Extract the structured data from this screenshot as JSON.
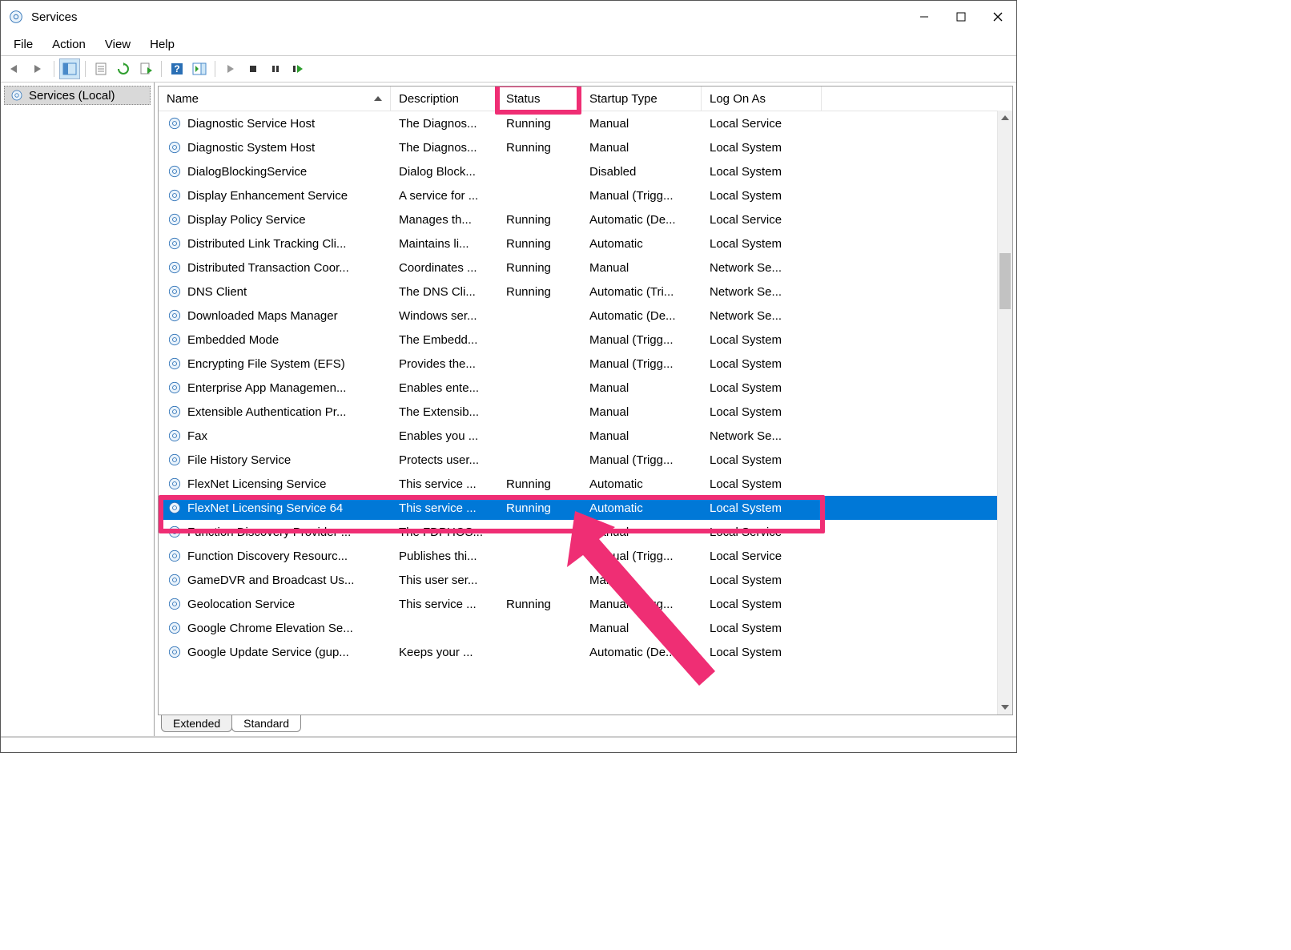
{
  "window": {
    "title": "Services"
  },
  "menubar": [
    "File",
    "Action",
    "View",
    "Help"
  ],
  "tree": {
    "root": "Services (Local)"
  },
  "columns": {
    "name": "Name",
    "description": "Description",
    "status": "Status",
    "startup": "Startup Type",
    "logon": "Log On As"
  },
  "tabs": {
    "extended": "Extended",
    "standard": "Standard"
  },
  "selected_index": 16,
  "highlight_column_index": 2,
  "services": [
    {
      "name": "Diagnostic Service Host",
      "description": "The Diagnos...",
      "status": "Running",
      "startup": "Manual",
      "logon": "Local Service"
    },
    {
      "name": "Diagnostic System Host",
      "description": "The Diagnos...",
      "status": "Running",
      "startup": "Manual",
      "logon": "Local System"
    },
    {
      "name": "DialogBlockingService",
      "description": "Dialog Block...",
      "status": "",
      "startup": "Disabled",
      "logon": "Local System"
    },
    {
      "name": "Display Enhancement Service",
      "description": "A service for ...",
      "status": "",
      "startup": "Manual (Trigg...",
      "logon": "Local System"
    },
    {
      "name": "Display Policy Service",
      "description": "Manages th...",
      "status": "Running",
      "startup": "Automatic (De...",
      "logon": "Local Service"
    },
    {
      "name": "Distributed Link Tracking Cli...",
      "description": "Maintains li...",
      "status": "Running",
      "startup": "Automatic",
      "logon": "Local System"
    },
    {
      "name": "Distributed Transaction Coor...",
      "description": "Coordinates ...",
      "status": "Running",
      "startup": "Manual",
      "logon": "Network Se..."
    },
    {
      "name": "DNS Client",
      "description": "The DNS Cli...",
      "status": "Running",
      "startup": "Automatic (Tri...",
      "logon": "Network Se..."
    },
    {
      "name": "Downloaded Maps Manager",
      "description": "Windows ser...",
      "status": "",
      "startup": "Automatic (De...",
      "logon": "Network Se..."
    },
    {
      "name": "Embedded Mode",
      "description": "The Embedd...",
      "status": "",
      "startup": "Manual (Trigg...",
      "logon": "Local System"
    },
    {
      "name": "Encrypting File System (EFS)",
      "description": "Provides the...",
      "status": "",
      "startup": "Manual (Trigg...",
      "logon": "Local System"
    },
    {
      "name": "Enterprise App Managemen...",
      "description": "Enables ente...",
      "status": "",
      "startup": "Manual",
      "logon": "Local System"
    },
    {
      "name": "Extensible Authentication Pr...",
      "description": "The Extensib...",
      "status": "",
      "startup": "Manual",
      "logon": "Local System"
    },
    {
      "name": "Fax",
      "description": "Enables you ...",
      "status": "",
      "startup": "Manual",
      "logon": "Network Se..."
    },
    {
      "name": "File History Service",
      "description": "Protects user...",
      "status": "",
      "startup": "Manual (Trigg...",
      "logon": "Local System"
    },
    {
      "name": "FlexNet Licensing Service",
      "description": "This service ...",
      "status": "Running",
      "startup": "Automatic",
      "logon": "Local System"
    },
    {
      "name": "FlexNet Licensing Service 64",
      "description": "This service ...",
      "status": "Running",
      "startup": "Automatic",
      "logon": "Local System"
    },
    {
      "name": "Function Discovery Provider ...",
      "description": "The FDPHOS...",
      "status": "",
      "startup": "Manual",
      "logon": "Local Service"
    },
    {
      "name": "Function Discovery Resourc...",
      "description": "Publishes thi...",
      "status": "",
      "startup": "Manual (Trigg...",
      "logon": "Local Service"
    },
    {
      "name": "GameDVR and Broadcast Us...",
      "description": "This user ser...",
      "status": "",
      "startup": "Manual",
      "logon": "Local System"
    },
    {
      "name": "Geolocation Service",
      "description": "This service ...",
      "status": "Running",
      "startup": "Manual (Trigg...",
      "logon": "Local System"
    },
    {
      "name": "Google Chrome Elevation Se...",
      "description": "",
      "status": "",
      "startup": "Manual",
      "logon": "Local System"
    },
    {
      "name": "Google Update Service (gup...",
      "description": "Keeps your ...",
      "status": "",
      "startup": "Automatic (De...",
      "logon": "Local System"
    }
  ]
}
